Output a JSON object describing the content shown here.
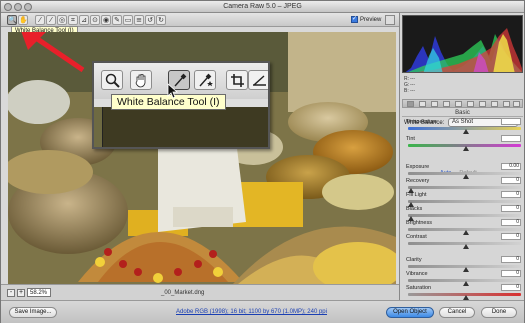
{
  "window": {
    "title": "Camera Raw 5.0 – JPEG"
  },
  "toolbar": {
    "tools": [
      {
        "icon": "zoom-icon",
        "glyph": "🔍"
      },
      {
        "icon": "hand-icon",
        "glyph": "✋"
      },
      {
        "icon": "white-balance-icon",
        "glyph": "⁄"
      },
      {
        "icon": "color-sampler-icon",
        "glyph": "⁄"
      },
      {
        "icon": "target-adjust-icon",
        "glyph": "◎"
      },
      {
        "icon": "crop-icon",
        "glyph": "⌗"
      },
      {
        "icon": "straighten-icon",
        "glyph": "⊿"
      },
      {
        "icon": "spot-removal-icon",
        "glyph": "⊙"
      },
      {
        "icon": "red-eye-icon",
        "glyph": "◉"
      },
      {
        "icon": "adjustment-brush-icon",
        "glyph": "✎"
      },
      {
        "icon": "graduated-filter-icon",
        "glyph": "▭"
      },
      {
        "icon": "preferences-icon",
        "glyph": "≡"
      },
      {
        "icon": "rotate-left-icon",
        "glyph": "↺"
      },
      {
        "icon": "rotate-right-icon",
        "glyph": "↻"
      }
    ],
    "preview_label": "Preview",
    "small_tooltip": "White Balance Tool (I)"
  },
  "callout": {
    "tooltip": "White Balance Tool (I)",
    "tools": [
      "zoom-icon",
      "hand-icon",
      "white-balance-icon",
      "color-sampler-icon",
      "crop-icon",
      "straighten-icon"
    ]
  },
  "arrow_color": "#e8202a",
  "image_status": {
    "zoom": "58.2%",
    "filename": "_00_Market.dng"
  },
  "histogram": {
    "readout": [
      {
        "label": "R:",
        "value": "---"
      },
      {
        "label": "G:",
        "value": "---"
      },
      {
        "label": "B:",
        "value": "---"
      }
    ]
  },
  "basic_panel": {
    "header": "Basic",
    "white_balance_label": "White Balance:",
    "white_balance_value": "As Shot",
    "auto_label": "Auto",
    "default_label": "Default",
    "sliders": [
      {
        "label": "Temperature",
        "value": "",
        "pos": 0.5,
        "track": "temp"
      },
      {
        "label": "Tint",
        "value": "",
        "pos": 0.5,
        "track": "tint"
      },
      {
        "label": "Exposure",
        "value": "0.00",
        "pos": 0.5,
        "track": "plain"
      },
      {
        "label": "Recovery",
        "value": "0",
        "pos": 0.0,
        "track": "plain"
      },
      {
        "label": "Fill Light",
        "value": "0",
        "pos": 0.0,
        "track": "plain"
      },
      {
        "label": "Blacks",
        "value": "0",
        "pos": 0.0,
        "track": "plain"
      },
      {
        "label": "Brightness",
        "value": "0",
        "pos": 0.5,
        "track": "plain"
      },
      {
        "label": "Contrast",
        "value": "0",
        "pos": 0.5,
        "track": "plain"
      },
      {
        "label": "Clarity",
        "value": "0",
        "pos": 0.5,
        "track": "plain"
      },
      {
        "label": "Vibrance",
        "value": "0",
        "pos": 0.5,
        "track": "plain"
      },
      {
        "label": "Saturation",
        "value": "0",
        "pos": 0.5,
        "track": "sat"
      }
    ]
  },
  "bottom": {
    "save_label": "Save Image...",
    "workflow": "Adobe RGB (1998); 16 bit; 1100 by 670 (1.0MP); 240 ppi",
    "open_label": "Open Object",
    "cancel_label": "Cancel",
    "done_label": "Done"
  }
}
